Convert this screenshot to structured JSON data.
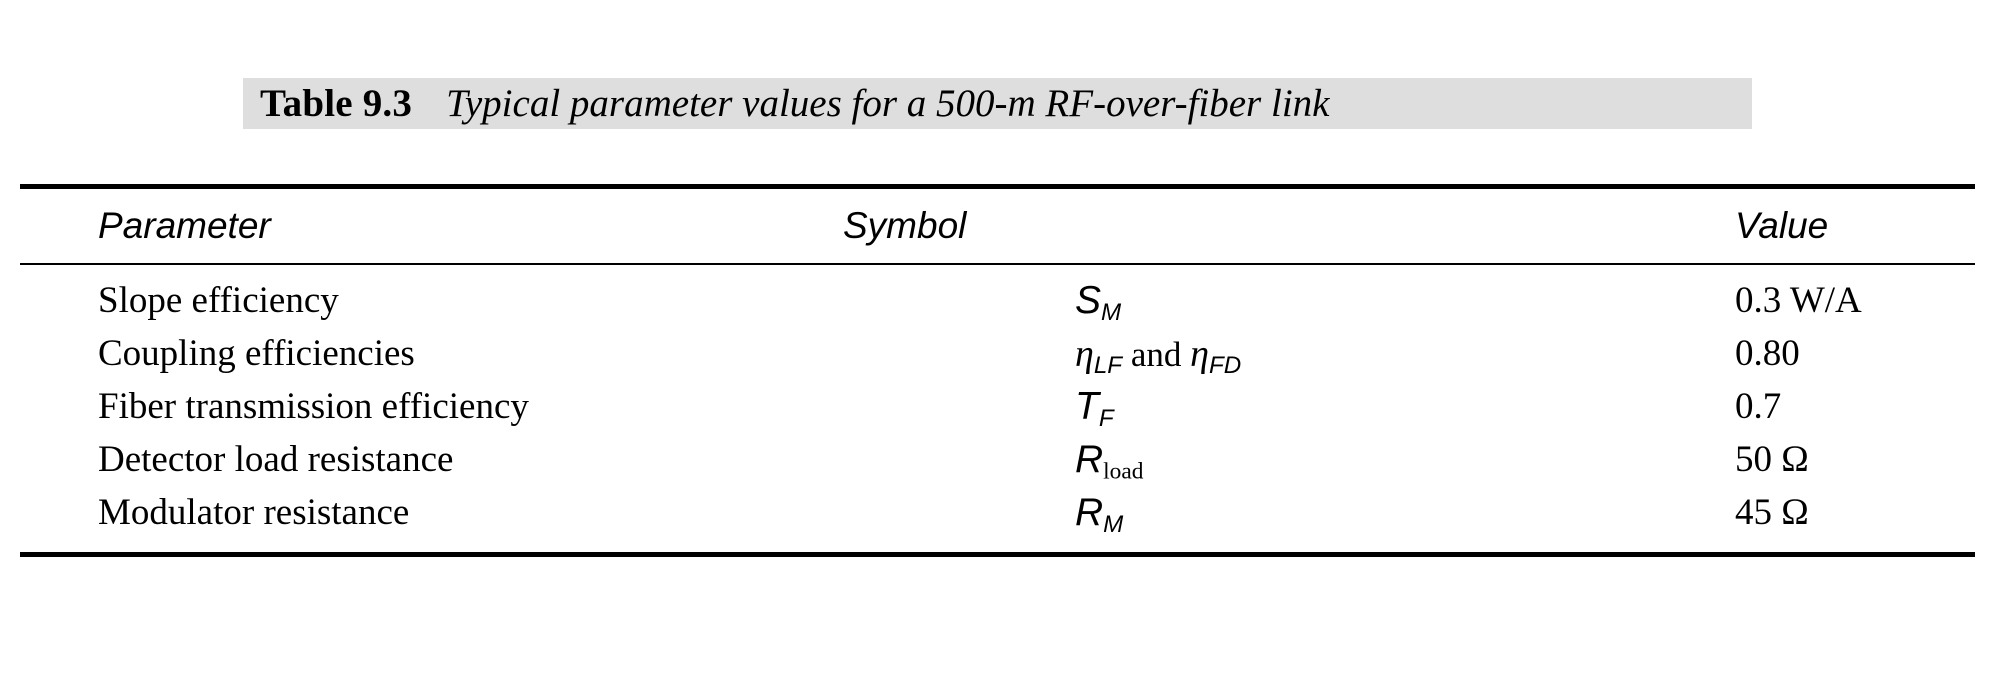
{
  "caption": {
    "label": "Table 9.3",
    "text": "Typical parameter values for a 500-m RF-over-fiber link",
    "band_color": "#dedede"
  },
  "table": {
    "columns": [
      {
        "key": "parameter",
        "header": "Parameter"
      },
      {
        "key": "symbol",
        "header": "Symbol"
      },
      {
        "key": "value",
        "header": "Value"
      }
    ],
    "rows": [
      {
        "parameter": "Slope efficiency",
        "symbol_plain": "S_M",
        "symbol_base": "S",
        "symbol_sub": "M",
        "value": "0.3 W/A"
      },
      {
        "parameter": "Coupling efficiencies",
        "symbol_plain": "η_LF and η_FD",
        "symbol_base": "η",
        "symbol_sub": "LF",
        "symbol_conjunction": " and ",
        "symbol_base2": "η",
        "symbol_sub2": "FD",
        "value": "0.80"
      },
      {
        "parameter": "Fiber transmission efficiency",
        "symbol_plain": "T_F",
        "symbol_base": "T",
        "symbol_sub": "F",
        "value": "0.7"
      },
      {
        "parameter": "Detector load resistance",
        "symbol_plain": "R_load",
        "symbol_base": "R",
        "symbol_sub": "load",
        "value": "50 Ω"
      },
      {
        "parameter": "Modulator resistance",
        "symbol_plain": "R_M",
        "symbol_base": "R",
        "symbol_sub": "M",
        "value": "45 Ω"
      }
    ]
  }
}
